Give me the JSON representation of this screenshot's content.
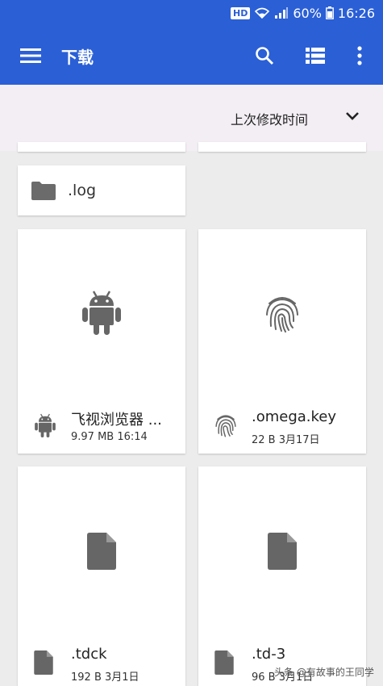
{
  "status_bar": {
    "hd_badge": "HD",
    "battery_percent": "60%",
    "time": "16:26"
  },
  "app_bar": {
    "title": "下载",
    "icons": [
      "menu-icon",
      "search-icon",
      "list-view-icon",
      "more-vert-icon"
    ],
    "color": "#2a5fd6"
  },
  "sort_bar": {
    "label": "上次修改时间"
  },
  "folders": [
    {
      "name": ".log"
    }
  ],
  "files": [
    {
      "name": "飞视浏览器 ...",
      "meta": "9.97 MB 16:14",
      "icon": "android-icon"
    },
    {
      "name": ".omega.key",
      "meta": "22 B 3月17日",
      "icon": "fingerprint-icon"
    },
    {
      "name": ".tdck",
      "meta": "192 B 3月1日",
      "icon": "file-icon"
    },
    {
      "name": ".td-3",
      "meta": "96 B 3月1日",
      "icon": "file-icon"
    }
  ],
  "watermark": "头条 @有故事的王同学"
}
